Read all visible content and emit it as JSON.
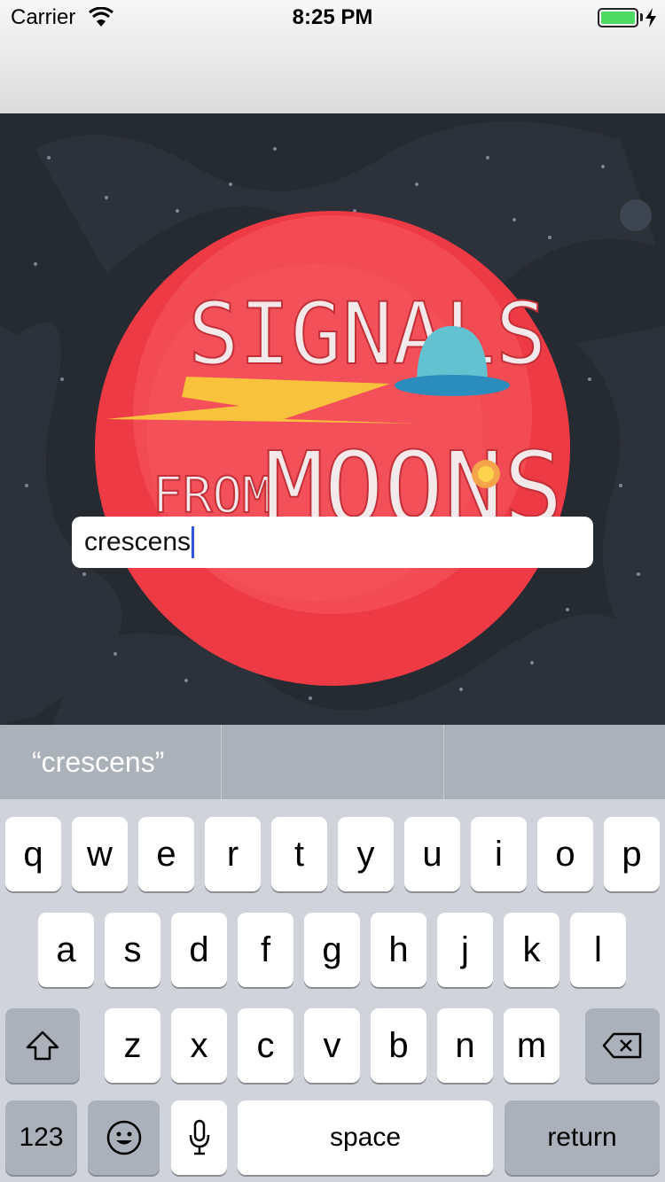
{
  "status_bar": {
    "carrier": "Carrier",
    "time": "8:25 PM",
    "battery_level": 1.0,
    "battery_color": "#4cd964"
  },
  "artwork": {
    "title_line1": "SIGNALS",
    "title_line2": "FROM",
    "title_line3": "MOONS",
    "background_color": "#262a31",
    "planet_color": "#ee3a44"
  },
  "search_field": {
    "value": "crescens"
  },
  "predictive": {
    "suggestions": [
      "“crescens”",
      "",
      ""
    ]
  },
  "keyboard": {
    "row1": [
      "q",
      "w",
      "e",
      "r",
      "t",
      "y",
      "u",
      "i",
      "o",
      "p"
    ],
    "row2": [
      "a",
      "s",
      "d",
      "f",
      "g",
      "h",
      "j",
      "k",
      "l"
    ],
    "row3": [
      "z",
      "x",
      "c",
      "v",
      "b",
      "n",
      "m"
    ],
    "shift_icon": "shift-icon",
    "delete_icon": "delete-icon",
    "numbers_label": "123",
    "emoji_icon": "emoji-icon",
    "mic_icon": "microphone-icon",
    "space_label": "space",
    "return_label": "return"
  }
}
